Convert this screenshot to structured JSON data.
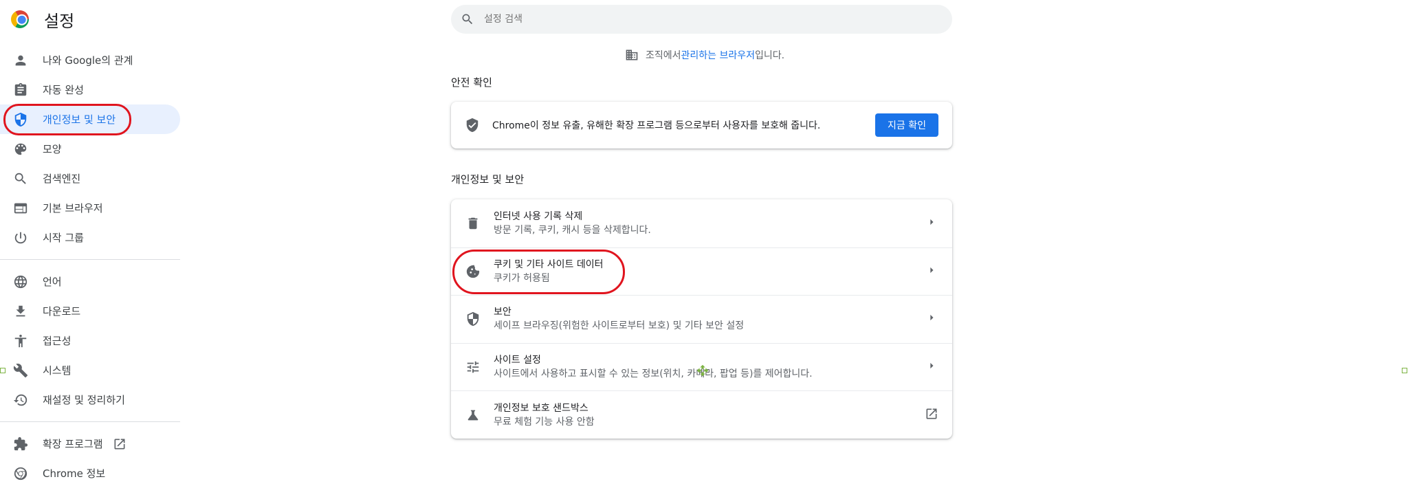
{
  "header": {
    "title": "설정"
  },
  "nav": {
    "items": [
      {
        "label": "나와 Google의 관계",
        "icon": "person-icon"
      },
      {
        "label": "자동 완성",
        "icon": "clipboard-icon"
      },
      {
        "label": "개인정보 및 보안",
        "icon": "shield-icon"
      },
      {
        "label": "모양",
        "icon": "palette-icon"
      },
      {
        "label": "검색엔진",
        "icon": "search-icon"
      },
      {
        "label": "기본 브라우저",
        "icon": "browser-icon"
      },
      {
        "label": "시작 그룹",
        "icon": "power-icon"
      }
    ],
    "advanced": [
      {
        "label": "언어",
        "icon": "globe-icon"
      },
      {
        "label": "다운로드",
        "icon": "download-icon"
      },
      {
        "label": "접근성",
        "icon": "accessibility-icon"
      },
      {
        "label": "시스템",
        "icon": "wrench-icon"
      },
      {
        "label": "재설정 및 정리하기",
        "icon": "history-icon"
      }
    ],
    "footer": [
      {
        "label": "확장 프로그램",
        "icon": "puzzle-icon"
      },
      {
        "label": "Chrome 정보",
        "icon": "chrome-icon"
      }
    ]
  },
  "search": {
    "placeholder": "설정 검색"
  },
  "managed": {
    "prefix": "조직에서 ",
    "link": "관리하는 브라우저",
    "suffix": "입니다."
  },
  "safety": {
    "title": "안전 확인",
    "text": "Chrome이 정보 유출, 유해한 확장 프로그램 등으로부터 사용자를 보호해 줍니다.",
    "button": "지금 확인"
  },
  "privacy": {
    "title": "개인정보 및 보안",
    "rows": [
      {
        "title": "인터넷 사용 기록 삭제",
        "sub": "방문 기록, 쿠키, 캐시 등을 삭제합니다.",
        "icon": "trash-icon"
      },
      {
        "title": "쿠키 및 기타 사이트 데이터",
        "sub": "쿠키가 허용됨",
        "icon": "cookie-icon"
      },
      {
        "title": "보안",
        "sub": "세이프 브라우징(위험한 사이트로부터 보호) 및 기타 보안 설정",
        "icon": "security-shield-icon"
      },
      {
        "title": "사이트 설정",
        "sub": "사이트에서 사용하고 표시할 수 있는 정보(위치, 카메라, 팝업 등)를 제어합니다.",
        "icon": "tune-icon"
      },
      {
        "title": "개인정보 보호 샌드박스",
        "sub": "무료 체험 기능 사용 안함",
        "icon": "flask-icon"
      }
    ]
  },
  "colors": {
    "accent": "#1a73e8",
    "annotation": "#e0141e",
    "selectedBg": "#e8f0fe"
  }
}
